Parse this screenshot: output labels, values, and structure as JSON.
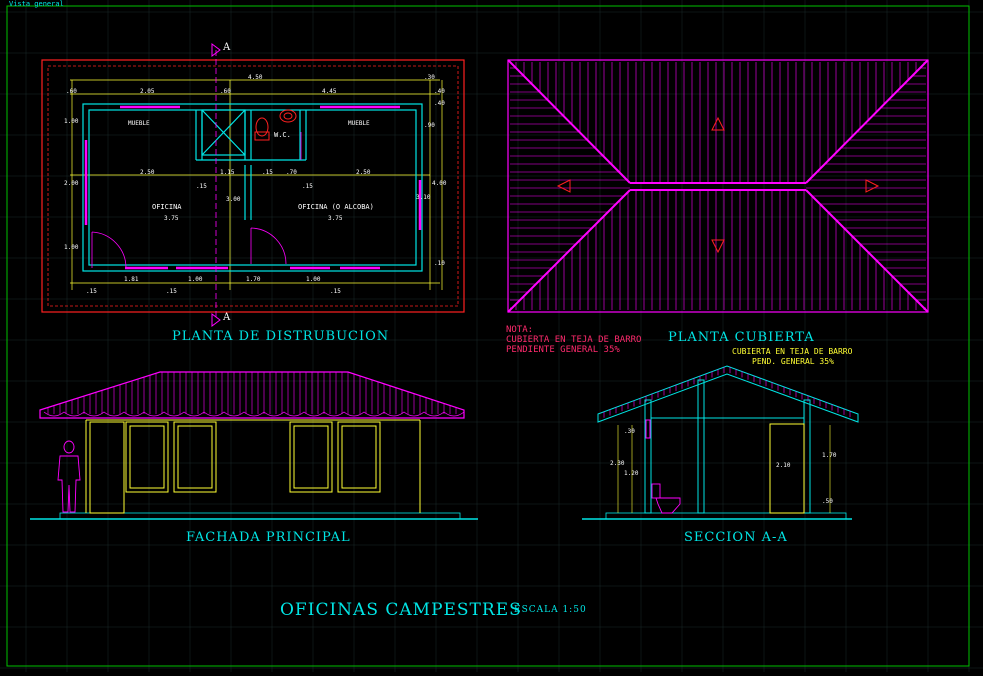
{
  "header_text": "Vista general",
  "plan": {
    "title": "PLANTA DE DISTRUBUCION",
    "section_mark": "A",
    "dims_top": [
      "4.50",
      ".60",
      "2.05",
      ".60",
      "4.45",
      ".30",
      ".40"
    ],
    "dims_mid": [
      "2.50",
      ".15",
      "1.15",
      ".15",
      ".70",
      ".15",
      "2.50"
    ],
    "dims_bottom": [
      "1.81",
      "1.00",
      "1.70",
      "1.00",
      ".15",
      ".15",
      ".15"
    ],
    "dims_left": [
      "1.00",
      "2.00",
      "1.00",
      "3.00"
    ],
    "dims_right": [
      "4.00",
      "3.10",
      ".40",
      ".10",
      ".90"
    ],
    "rooms": {
      "mueble_left": "MUEBLE",
      "mueble_right": "MUEBLE",
      "wc": "W.C.",
      "oficina": "OFICINA",
      "oficina_alcoba": "OFICINA (O ALCOBA)",
      "room_dim_left": "3.75",
      "room_dim_right": "3.75"
    }
  },
  "roof": {
    "title": "PLANTA CUBIERTA",
    "note_label": "NOTA:",
    "note_line1": "CUBIERTA EN TEJA DE BARRO",
    "note_line2": "PENDIENTE GENERAL 35%"
  },
  "facade": {
    "title": "FACHADA PRINCIPAL"
  },
  "section": {
    "title": "SECCION A-A",
    "note_line1": "CUBIERTA EN TEJA DE BARRO",
    "note_line2": "PEND. GENERAL 35%",
    "dims": [
      "2.30",
      "1.20",
      ".30",
      "2.10",
      "1.70",
      ".50"
    ]
  },
  "footer": {
    "title": "OFICINAS  CAMPESTRES",
    "scale": "ESCALA 1:50"
  },
  "colors": {
    "background": "#000000",
    "cyan": "#00e5e5",
    "magenta": "#ff00ff",
    "red": "#ff2020",
    "yellow": "#ffff33",
    "green_frame": "#00c000",
    "grid": "#1a2a2a"
  }
}
